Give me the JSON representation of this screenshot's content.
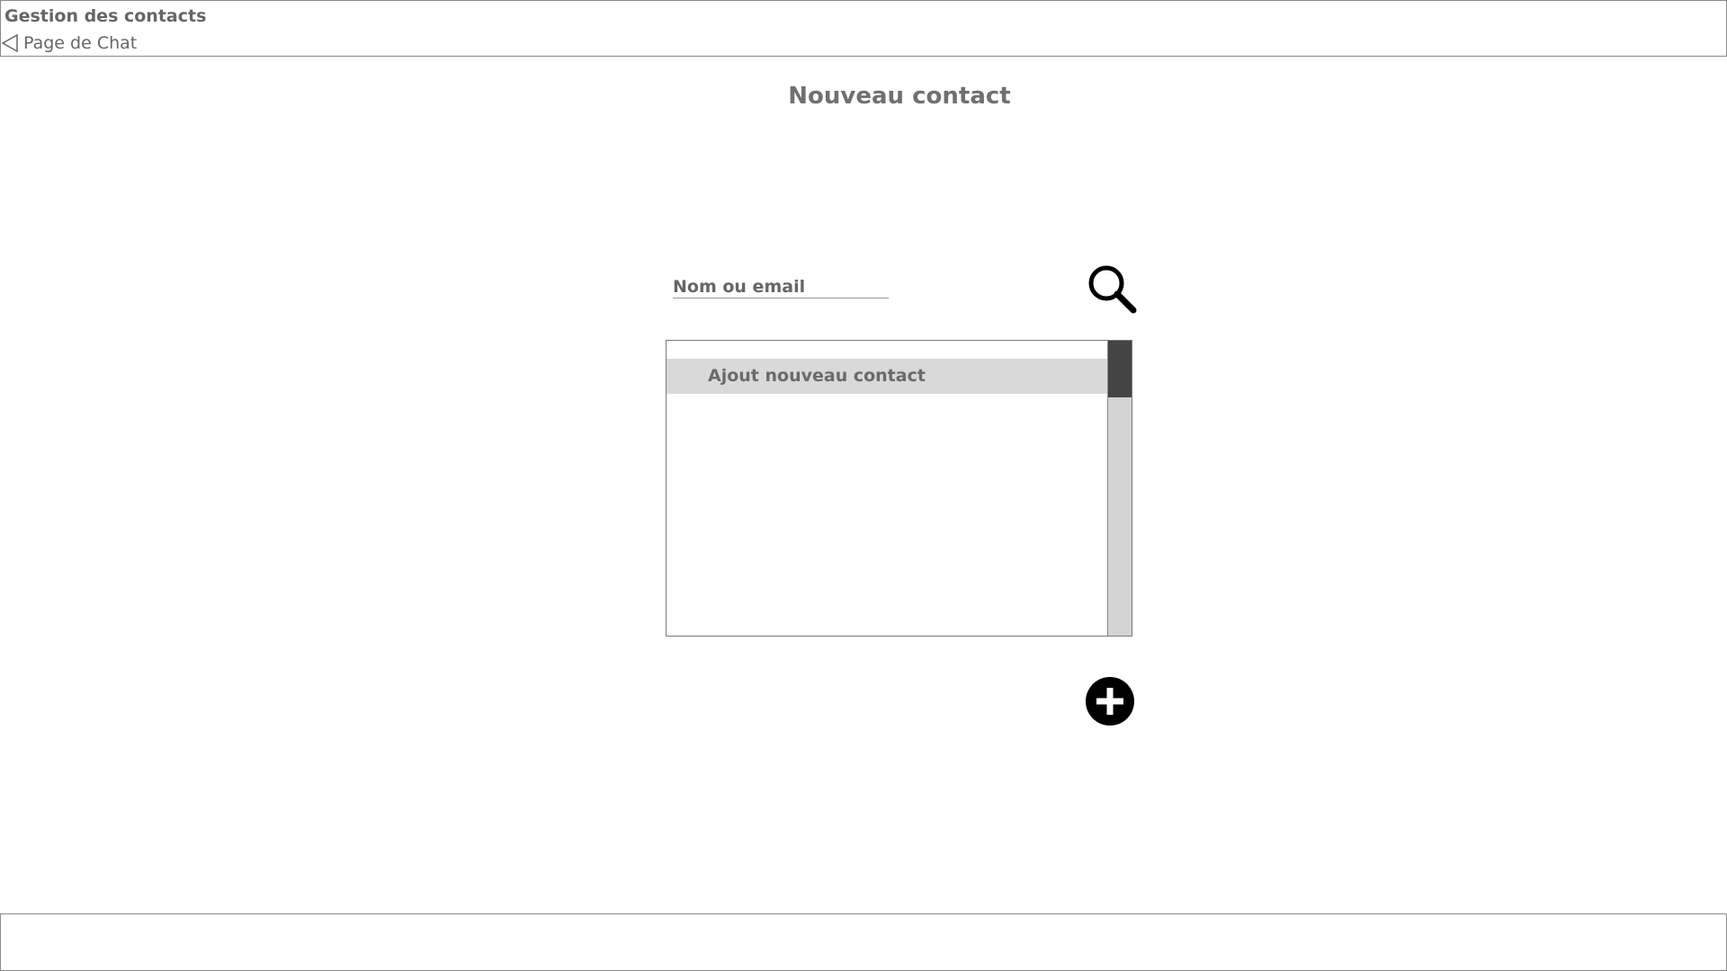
{
  "header": {
    "title": "Gestion des contacts",
    "back_label": "Page de Chat",
    "back_icon": "triangle-left-icon"
  },
  "page": {
    "title": "Nouveau contact"
  },
  "search": {
    "placeholder": "Nom ou email",
    "value": "",
    "icon": "search-icon"
  },
  "contact_list": {
    "items": [
      {
        "label": "Ajout nouveau contact",
        "selected": true
      }
    ]
  },
  "actions": {
    "add_icon": "plus-circle-icon"
  },
  "colors": {
    "text": "#666666",
    "border": "#8a8a8a",
    "selected_row": "#d9d9d9",
    "scroll_track": "#d4d4d4",
    "scroll_thumb": "#444444",
    "icon": "#000000"
  }
}
